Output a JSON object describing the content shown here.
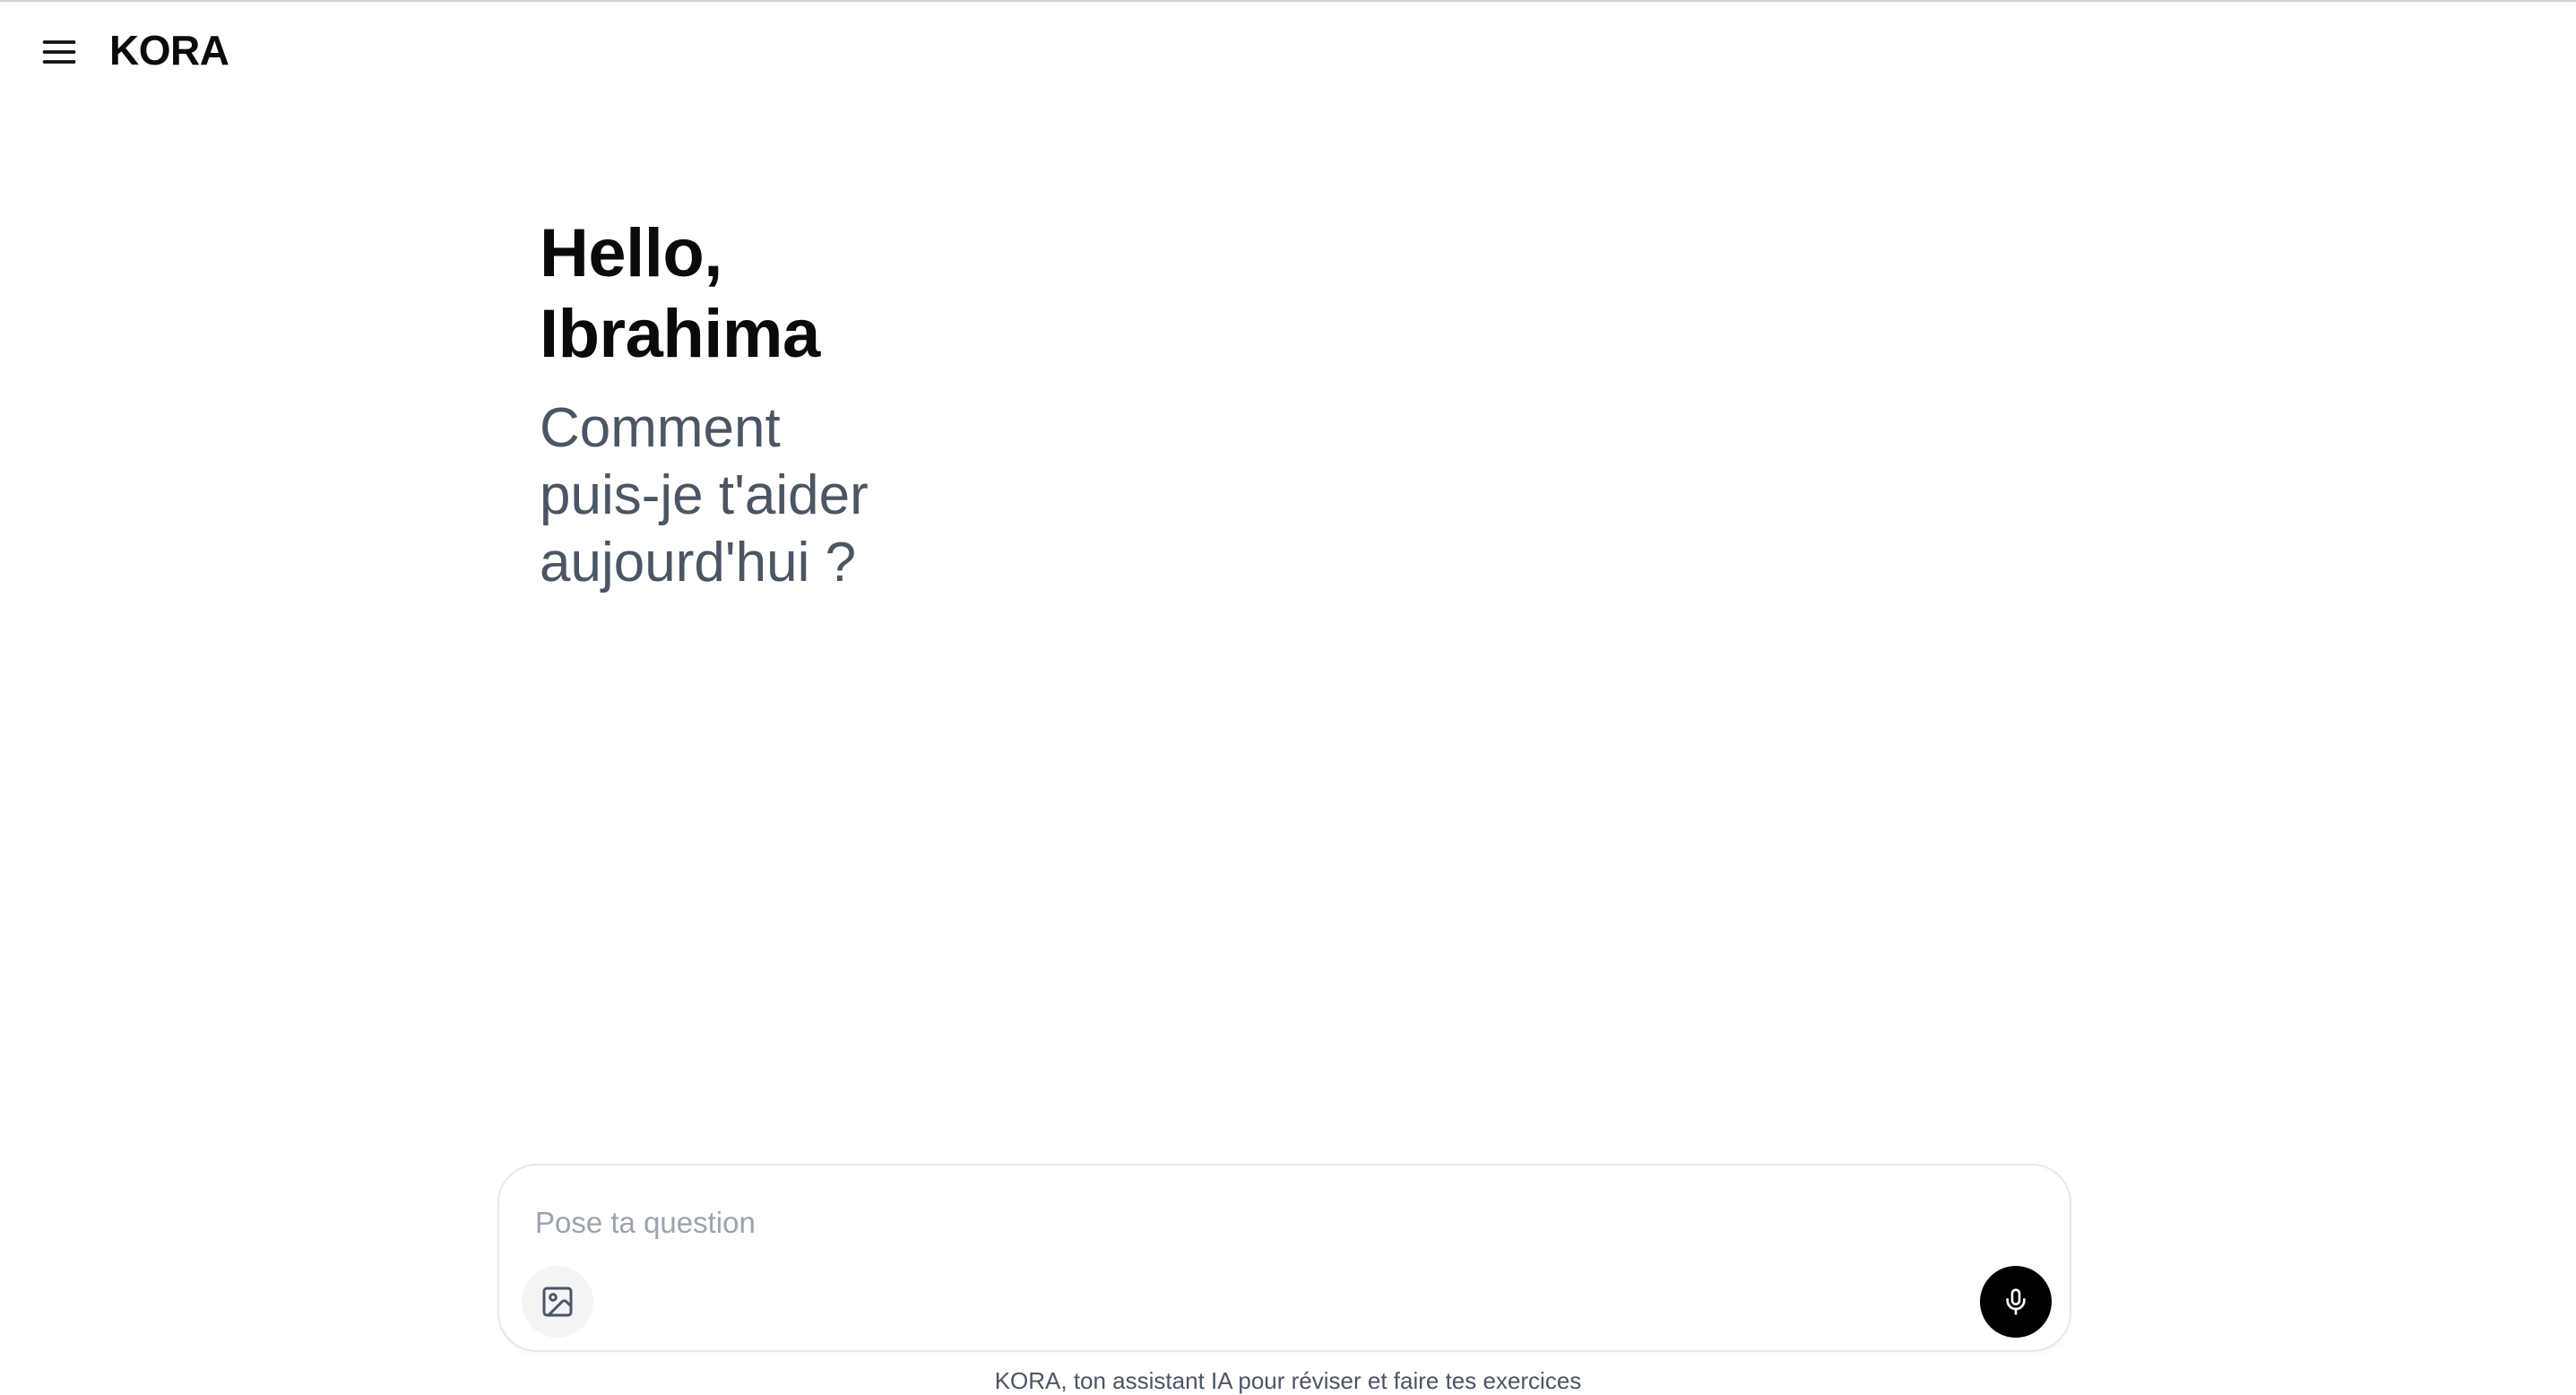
{
  "app": {
    "brand": "KORA"
  },
  "header": {
    "menu_icon": "hamburger-menu-icon"
  },
  "greeting": {
    "hello_line1": "Hello,",
    "hello_line2": "Ibrahima",
    "prompt_line1": "Comment",
    "prompt_line2": "puis-je t'aider",
    "prompt_line3": "aujourd'hui ?"
  },
  "composer": {
    "placeholder": "Pose ta question",
    "value": "",
    "image_icon": "image-icon",
    "mic_icon": "microphone-icon"
  },
  "footer": {
    "note": "KORA, ton assistant IA pour réviser et faire tes exercices"
  },
  "colors": {
    "text_primary": "#0a0a0a",
    "text_secondary": "#4b5563",
    "placeholder": "#9ca3af",
    "mic_button_bg": "#000000",
    "image_button_bg": "#f3f4f6",
    "composer_border": "#e5e7eb"
  }
}
